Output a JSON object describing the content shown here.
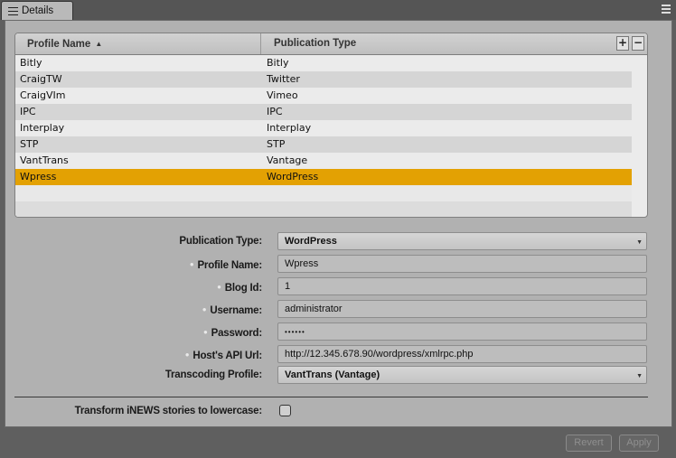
{
  "tab": {
    "label": "Details"
  },
  "table": {
    "headers": {
      "profile": "Profile Name",
      "publication": "Publication Type"
    },
    "add_label": "+",
    "remove_label": "−",
    "rows": [
      {
        "profile": "Bitly",
        "publication": "Bitly"
      },
      {
        "profile": "CraigTW",
        "publication": "Twitter"
      },
      {
        "profile": "CraigVIm",
        "publication": "Vimeo"
      },
      {
        "profile": "IPC",
        "publication": "IPC"
      },
      {
        "profile": "Interplay",
        "publication": "Interplay"
      },
      {
        "profile": "STP",
        "publication": "STP"
      },
      {
        "profile": "VantTrans",
        "publication": "Vantage"
      },
      {
        "profile": "Wpress",
        "publication": "WordPress"
      }
    ],
    "selected_row": "Wpress"
  },
  "form": {
    "publication_type": {
      "label": "Publication Type:",
      "value": "WordPress"
    },
    "profile_name": {
      "label": "Profile Name:",
      "value": "Wpress"
    },
    "blog_id": {
      "label": "Blog Id:",
      "value": "1"
    },
    "username": {
      "label": "Username:",
      "value": "administrator"
    },
    "password": {
      "label": "Password:",
      "value": "••••••"
    },
    "api_url": {
      "label": "Host's API Url:",
      "value": "http://12.345.678.90/wordpress/xmlrpc.php"
    },
    "transcoding_profile": {
      "label": "Transcoding Profile:",
      "value": "VantTrans (Vantage)"
    },
    "lowercase": {
      "label": "Transform iNEWS stories to lowercase:",
      "checked": false
    }
  },
  "footer": {
    "revert_label": "Revert",
    "apply_label": "Apply"
  },
  "colors": {
    "selection": "#e3a103",
    "panel": "#b1b1b1",
    "background": "#5f5f5f"
  }
}
